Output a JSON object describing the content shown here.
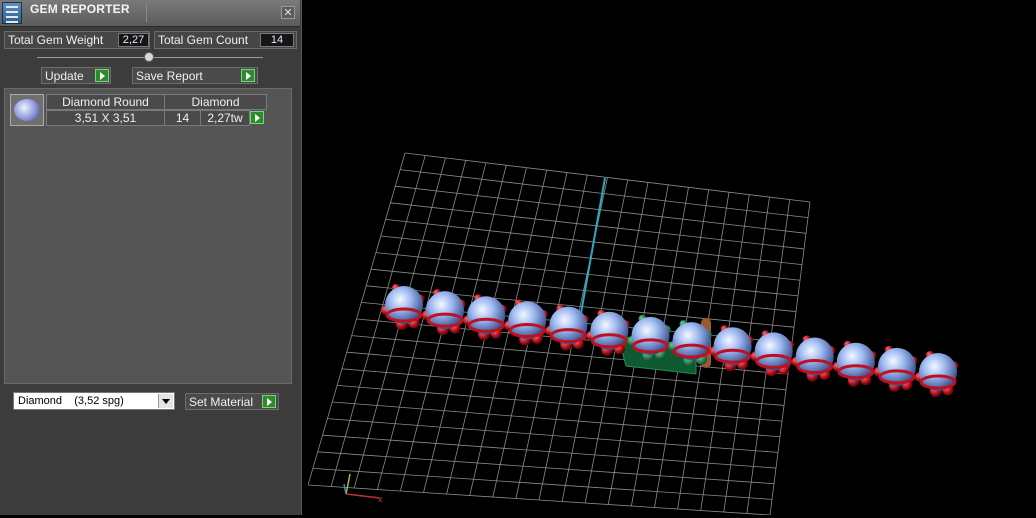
{
  "window": {
    "title": "GEM REPORTER",
    "close_glyph": "✕"
  },
  "stats": {
    "total_weight_label": "Total Gem Weight",
    "total_weight_value": "2,27",
    "total_count_label": "Total Gem Count",
    "total_count_value": "14"
  },
  "toolbar": {
    "update_label": "Update",
    "save_report_label": "Save Report"
  },
  "gem_list": {
    "items": [
      {
        "shape": "Diamond Round",
        "material": "Diamond",
        "size": "3,51 X 3,51",
        "count": "14",
        "weight": "2,27tw"
      }
    ]
  },
  "material": {
    "selected": "Diamond    (3,52 spg)",
    "set_material_label": "Set Material"
  },
  "colors": {
    "panel_bg": "#3c3c3c",
    "accent_green": "#2e8a2e",
    "gem_blue": "#8fb0f0",
    "prong_red": "#b0101a"
  },
  "icons": [
    "app-icon",
    "close-icon",
    "play-arrow-icon",
    "chevron-down-icon",
    "gem-thumbnail-icon",
    "axis-gizmo-icon"
  ],
  "viewport": {
    "stone_count": 14
  }
}
